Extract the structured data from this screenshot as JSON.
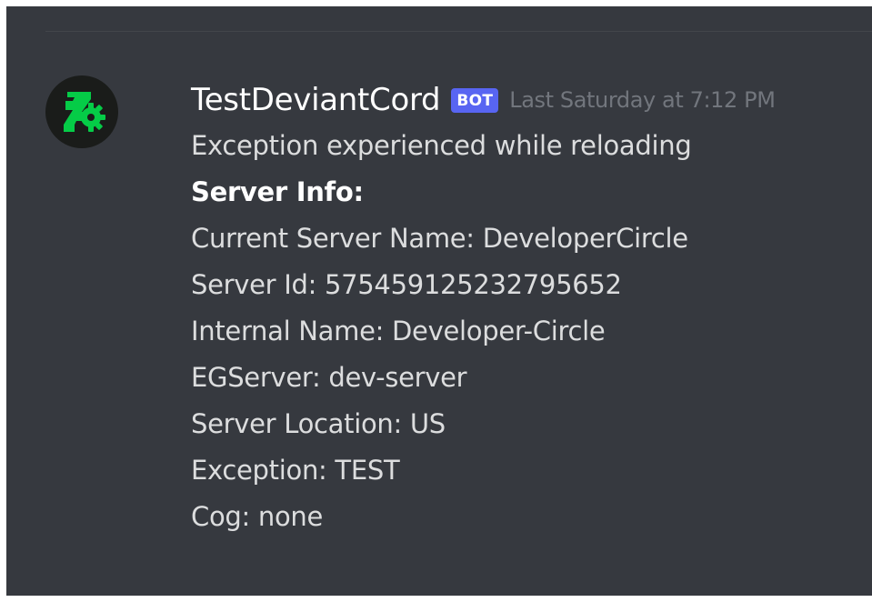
{
  "message": {
    "author": "TestDeviantCord",
    "bot_tag": "BOT",
    "timestamp": "Last Saturday at 7:12 PM",
    "lines": [
      "Exception experienced while reloading",
      "Server Info:",
      "Current Server Name: DeveloperCircle",
      "Server Id: 575459125232795652",
      "Internal Name: Developer-Circle",
      "EGServer: dev-server",
      "Server Location: US",
      "Exception: TEST",
      "Cog: none"
    ]
  },
  "avatar": {
    "icon": "deviantart-gear-logo-icon",
    "color": "#05cc47",
    "background": "#1a1c1a"
  },
  "colors": {
    "background": "#36393f",
    "bot_tag": "#5865f2",
    "timestamp": "#72767d",
    "text": "#dcddde"
  }
}
